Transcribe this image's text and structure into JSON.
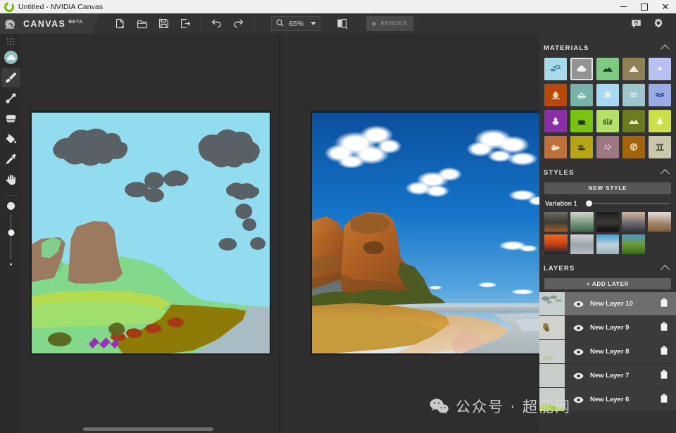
{
  "window": {
    "title": "Untitled - NVIDIA Canvas",
    "app_icon": "nvidia-canvas-icon",
    "minimize": "–",
    "maximize": "□",
    "close": "✕"
  },
  "brand": {
    "name": "CANVAS",
    "tag": "BETA",
    "logo": "nvidia-eye-logo"
  },
  "toolbar": {
    "new_label": "new-file-icon",
    "open_label": "open-folder-icon",
    "save_label": "save-disk-icon",
    "export_label": "export-icon",
    "undo_label": "undo-icon",
    "redo_label": "redo-icon",
    "zoom_icon": "magnifier-icon",
    "zoom_value": "65%",
    "zoom_caret": "chevron-down-icon",
    "split_view_icon": "split-view-icon",
    "render_label": "RENDER",
    "feedback_icon": "feedback-icon",
    "settings_icon": "gear-icon"
  },
  "left_rail": {
    "grip": "drag-grip",
    "tools": [
      {
        "name": "material-swatch",
        "label": "Material"
      },
      {
        "name": "paint-brush",
        "label": "Paint Brush"
      },
      {
        "name": "line-tool",
        "label": "Line"
      },
      {
        "name": "eraser",
        "label": "Eraser"
      },
      {
        "name": "fill-bucket",
        "label": "Fill"
      },
      {
        "name": "eyedropper",
        "label": "Eyedropper"
      },
      {
        "name": "pan-hand",
        "label": "Pan"
      }
    ],
    "selected_tool": "paint-brush",
    "brush_size": {
      "large_dot": "●",
      "small_dot": "·",
      "value": 35
    }
  },
  "canvas": {
    "left_pane_name": "sketch-canvas",
    "right_pane_name": "rendered-canvas",
    "left_scrollbar": "horizontal-scrollbar-left",
    "right_scrollbar": "horizontal-scrollbar-right"
  },
  "materials": {
    "title": "MATERIALS",
    "collapse_icon": "chevron-up-icon",
    "selected": "cloud",
    "items": [
      {
        "name": "sky",
        "label": "Sky",
        "bg": "#a8dbe8",
        "fg": "#2b6d86"
      },
      {
        "name": "cloud",
        "label": "Cloud",
        "bg": "#939393",
        "fg": "#f2f2f2"
      },
      {
        "name": "hill",
        "label": "Hill",
        "bg": "#7ccb80",
        "fg": "#15401a"
      },
      {
        "name": "mountain",
        "label": "Mountain",
        "bg": "#8f8259",
        "fg": "#f0ece0"
      },
      {
        "name": "sun",
        "label": "Sun",
        "bg": "#b7c2f0",
        "fg": "#f4f6ff"
      },
      {
        "name": "fire",
        "label": "Fire",
        "bg": "#b9490b",
        "fg": "#f4cfae"
      },
      {
        "name": "fog",
        "label": "Fog",
        "bg": "#77b3ab",
        "fg": "#e6f4f1"
      },
      {
        "name": "snow",
        "label": "Snow",
        "bg": "#a9d8f2",
        "fg": "#ffffff"
      },
      {
        "name": "water",
        "label": "Water",
        "bg": "#9fc6ca",
        "fg": "#e4f2f3"
      },
      {
        "name": "sea",
        "label": "Sea",
        "bg": "#9aabe6",
        "fg": "#23368c"
      },
      {
        "name": "flowers",
        "label": "Flowers",
        "bg": "#8a2fa8",
        "fg": "#f6e9fb"
      },
      {
        "name": "bush",
        "label": "Bush",
        "bg": "#79c40c",
        "fg": "#1d3a07"
      },
      {
        "name": "grass",
        "label": "Grass",
        "bg": "#b4e06a",
        "fg": "#2a5410"
      },
      {
        "name": "hills",
        "label": "Hills",
        "bg": "#6c7a20",
        "fg": "#e8ebcd"
      },
      {
        "name": "tree",
        "label": "Tree",
        "bg": "#cbdf48",
        "fg": "#f7fadf"
      },
      {
        "name": "sand",
        "label": "Sand",
        "bg": "#c0703c",
        "fg": "#f6e2c8"
      },
      {
        "name": "dirt",
        "label": "Dirt",
        "bg": "#b5a413",
        "fg": "#4e4504"
      },
      {
        "name": "gravel",
        "label": "Gravel",
        "bg": "#9d7882",
        "fg": "#e6d6da"
      },
      {
        "name": "rock",
        "label": "Rock",
        "bg": "#a3650b",
        "fg": "#efdcb8"
      },
      {
        "name": "ruins",
        "label": "Ruins",
        "bg": "#c9c8ab",
        "fg": "#4f4e36"
      }
    ]
  },
  "styles": {
    "title": "STYLES",
    "collapse_icon": "chevron-up-icon",
    "new_style_label": "NEW STYLE",
    "variation_label": "Variation 1",
    "variation_value": 0,
    "selected_index": 8,
    "thumbs": [
      {
        "name": "style-thumb-1",
        "sky": "#6d6f63",
        "mid": "#3a3b35",
        "gnd": "#a35c2a"
      },
      {
        "name": "style-thumb-2",
        "sky": "#cfd8cb",
        "mid": "#7e9c86",
        "gnd": "#3f6a4b"
      },
      {
        "name": "style-thumb-3",
        "sky": "#1b1b1b",
        "mid": "#3d3b38",
        "gnd": "#0d0d0d"
      },
      {
        "name": "style-thumb-4",
        "sky": "#d4b79a",
        "mid": "#7a6f74",
        "gnd": "#2f3a3f"
      },
      {
        "name": "style-thumb-5",
        "sky": "#e3e0dc",
        "mid": "#a98f74",
        "gnd": "#7d5d3c"
      },
      {
        "name": "style-thumb-6",
        "sky": "#f06a1e",
        "mid": "#c83c12",
        "gnd": "#102634"
      },
      {
        "name": "style-thumb-7",
        "sky": "#cfd3d6",
        "mid": "#9aa3a9",
        "gnd": "#b9bec2"
      },
      {
        "name": "style-thumb-8",
        "sky": "#3ea0d8",
        "mid": "#bfd3dd",
        "gnd": "#9fb0b5"
      },
      {
        "name": "style-thumb-9",
        "sky": "#4c9ad2",
        "mid": "#6f9b2e",
        "gnd": "#33691e"
      }
    ]
  },
  "layers": {
    "title": "LAYERS",
    "collapse_icon": "chevron-up-icon",
    "add_label": "+ ADD LAYER",
    "selected": "New Layer 10",
    "items": [
      {
        "name": "New Layer 10",
        "visible": true,
        "thumb": "cloud-strokes"
      },
      {
        "name": "New Layer 9",
        "visible": true,
        "thumb": "dirt-patch"
      },
      {
        "name": "New Layer 8",
        "visible": true,
        "thumb": "faint-green"
      },
      {
        "name": "New Layer 7",
        "visible": true,
        "thumb": "empty"
      },
      {
        "name": "New Layer 6",
        "visible": true,
        "thumb": "grass-strokes"
      }
    ],
    "eye_icon": "eye-icon",
    "delete_icon": "trash-icon"
  },
  "watermark": {
    "text": "公众号 · 超能网",
    "logo": "wechat-logo"
  },
  "colors": {
    "accent_green": "#76b900",
    "panel_bg": "#333333",
    "stage_bg": "#2e2e2e",
    "toolbar_bg": "#333333",
    "titlebar_bg": "#f0f0f0"
  }
}
